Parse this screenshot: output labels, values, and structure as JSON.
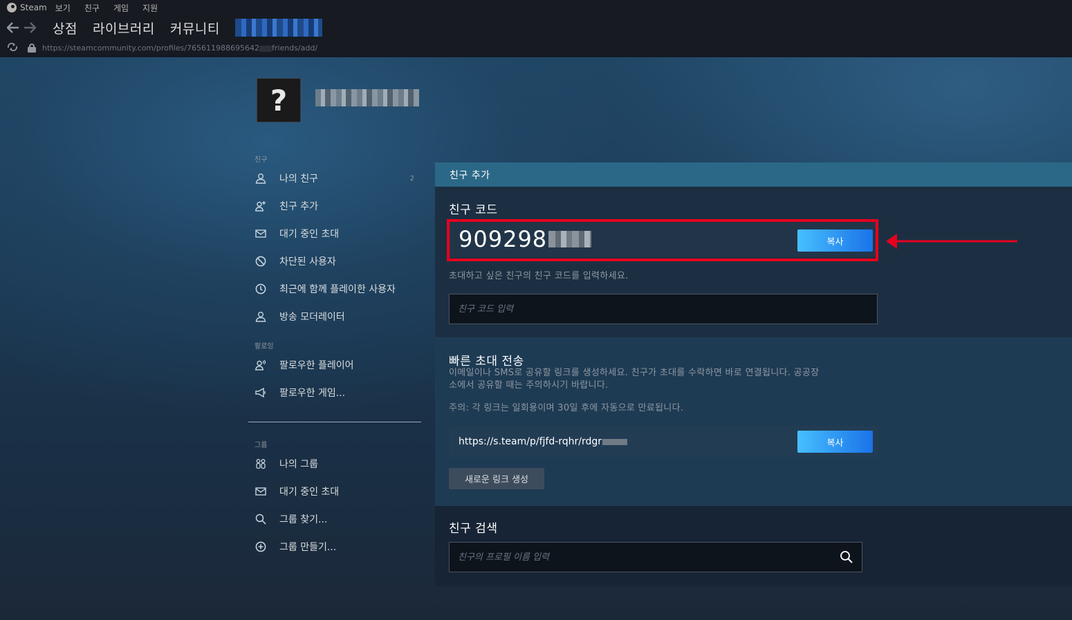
{
  "menubar": {
    "app_name": "Steam",
    "items": [
      "보기",
      "친구",
      "게임",
      "지원"
    ]
  },
  "navbar": {
    "links": [
      "상점",
      "라이브러리",
      "커뮤니티"
    ]
  },
  "url": {
    "prefix": "https://steamcommunity.com/profiles/765611988695642",
    "suffix": "friends/add/"
  },
  "profile": {
    "avatar_glyph": "?"
  },
  "sidebar": {
    "friends_section": "친구",
    "friends_items": [
      {
        "label": "나의 친구",
        "count": "2",
        "icon": "person-icon"
      },
      {
        "label": "친구 추가",
        "icon": "add-person-icon"
      },
      {
        "label": "대기 중인 초대",
        "icon": "envelope-icon"
      },
      {
        "label": "차단된 사용자",
        "icon": "block-icon"
      },
      {
        "label": "최근에 함께 플레이한 사용자",
        "icon": "clock-icon"
      },
      {
        "label": "방송 모더레이터",
        "icon": "person-icon"
      }
    ],
    "following_section": "팔로잉",
    "following_items": [
      {
        "label": "팔로우한 플레이어",
        "icon": "follow-person-icon"
      },
      {
        "label": "팔로우한 게임...",
        "icon": "megaphone-icon"
      }
    ],
    "groups_section": "그룹",
    "groups_items": [
      {
        "label": "나의 그룹",
        "icon": "group-icon"
      },
      {
        "label": "대기 중인 초대",
        "icon": "envelope-icon"
      },
      {
        "label": "그룹 찾기...",
        "icon": "search-icon"
      },
      {
        "label": "그룹 만들기...",
        "icon": "plus-circle-icon"
      }
    ]
  },
  "main": {
    "header": "친구 추가",
    "friend_code": {
      "title": "친구 코드",
      "value": "909298",
      "copy_label": "복사",
      "help": "초대하고 싶은 친구의 친구 코드를 입력하세요.",
      "input_placeholder": "친구 코드 입력"
    },
    "quick_invite": {
      "title": "빠른 초대 전송",
      "description": "이메일이나 SMS로 공유할 링크를 생성하세요. 친구가 초대를 수락하면 바로 연결됩니다. 공공장소에서 공유할 때는 주의하시기 바랍니다.",
      "description_line1": "이메일이나 SMS로 공유할 링크를 생성하세요. 친구가 초대를 수락하면 바로 연결됩니다. 공공장",
      "description_line2": "소에서 공유할 때는 주의하시기 바랍니다.",
      "note": "주의: 각 링크는 일회용이며 30일 후에 자동으로 만료됩니다.",
      "link": "https://s.team/p/fjfd-rqhr/rdgr",
      "copy_label": "복사",
      "generate_label": "새로운 링크 생성"
    },
    "search": {
      "title": "친구 검색",
      "placeholder": "친구의 프로필 이름 입력"
    }
  },
  "colors": {
    "highlight": "#e5001e",
    "accent_blue": "#1a73e8",
    "header_bar": "#2b6887"
  }
}
